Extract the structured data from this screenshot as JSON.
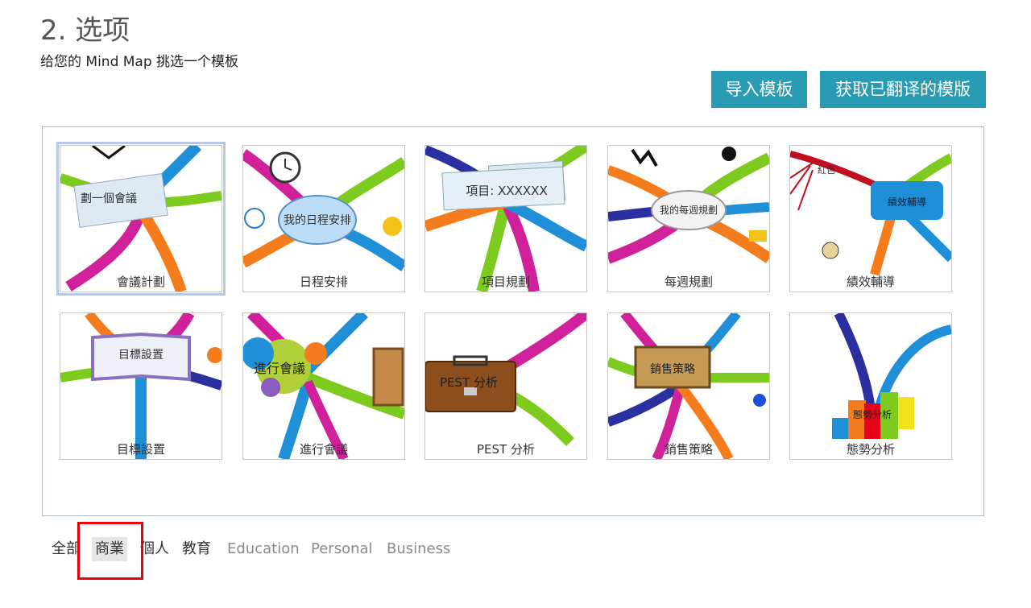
{
  "header": {
    "title": "2. 选项",
    "subtitle": "给您的 Mind Map 挑选一个模板"
  },
  "actions": {
    "import_label": "导入模板",
    "translated_label": "获取已翻译的模版"
  },
  "templates": [
    {
      "caption": "會議計劃",
      "center": "劃一個會議",
      "selected": true
    },
    {
      "caption": "日程安排",
      "center": "我的日程安排"
    },
    {
      "caption": "項目規劃",
      "center": "項目: XXXXXX"
    },
    {
      "caption": "每週規劃",
      "center": "我的每週規劃"
    },
    {
      "caption": "績效輔導",
      "center": "績效輔導",
      "branch": "紅色"
    },
    {
      "caption": "目標設置",
      "center": "目標設置"
    },
    {
      "caption": "進行會議",
      "center": "進行會議"
    },
    {
      "caption": "PEST 分析",
      "center": "PEST 分析"
    },
    {
      "caption": "銷售策略",
      "center": "銷售策略"
    },
    {
      "caption": "態勢分析",
      "center": "態勢分析"
    }
  ],
  "filters": [
    {
      "label": "全部",
      "lang": "zh"
    },
    {
      "label": "商業",
      "lang": "zh",
      "active": true
    },
    {
      "label": "個人",
      "lang": "zh"
    },
    {
      "label": "教育",
      "lang": "zh"
    },
    {
      "label": "Education",
      "lang": "en"
    },
    {
      "label": "Personal",
      "lang": "en"
    },
    {
      "label": "Business",
      "lang": "en"
    }
  ],
  "colors": {
    "accent": "#2a9bb5",
    "highlight": "#e8000b",
    "branch_green": "#7ccb1e",
    "branch_blue": "#1f8fd8",
    "branch_orange": "#f47c1c",
    "branch_magenta": "#d0209a",
    "branch_navy": "#2b2fa0",
    "branch_red": "#c01020"
  }
}
